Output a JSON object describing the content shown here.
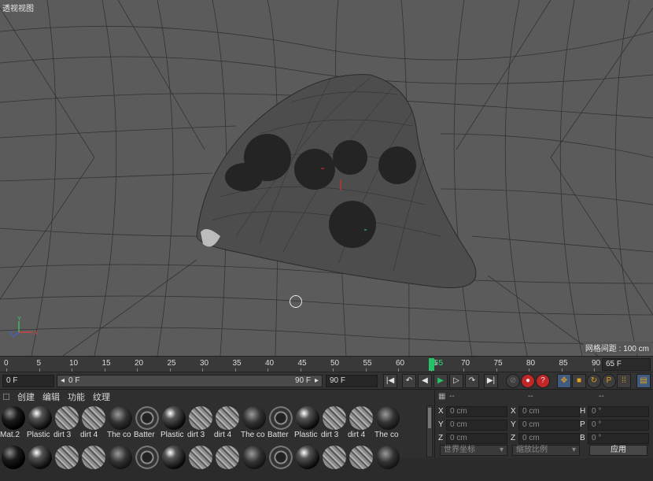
{
  "viewport": {
    "title": "透视视图",
    "grid_spacing": "网格间距 : 100 cm",
    "axes": {
      "x": "X",
      "y": "Y",
      "z": "Z"
    }
  },
  "timeline": {
    "ticks": [
      "0",
      "5",
      "10",
      "15",
      "20",
      "25",
      "30",
      "35",
      "40",
      "45",
      "50",
      "55",
      "60",
      "65",
      "70",
      "75",
      "80",
      "85",
      "90"
    ],
    "current_frame_label": "65",
    "current_frame": 65,
    "frame_field": "65 F"
  },
  "transport": {
    "start_field": "0 F",
    "range_start": "0 F",
    "range_end": "90 F",
    "end_field": "90 F",
    "buttons": [
      {
        "name": "go-to-start-button",
        "glyph": "|◀"
      },
      {
        "name": "prev-key-button",
        "glyph": "↶"
      },
      {
        "name": "prev-frame-button",
        "glyph": "◀"
      },
      {
        "name": "play-button",
        "glyph": "▶"
      },
      {
        "name": "next-frame-button",
        "glyph": "▷"
      },
      {
        "name": "next-key-button",
        "glyph": "↷"
      },
      {
        "name": "go-to-end-button",
        "glyph": "▶|"
      }
    ],
    "accent_play": "#26c26b",
    "accent_record": "#d93030",
    "accent_key": "#e0a020"
  },
  "material_manager": {
    "menu": [
      "创建",
      "编辑",
      "功能",
      "纹理"
    ],
    "materials": [
      {
        "label": "Mat.2",
        "kind": "black"
      },
      {
        "label": "Plastic",
        "kind": "plastic"
      },
      {
        "label": "dirt 3",
        "kind": "dirt"
      },
      {
        "label": "dirt 4",
        "kind": "dirt"
      },
      {
        "label": "The co",
        "kind": "coat"
      },
      {
        "label": "Batter",
        "kind": "battery"
      },
      {
        "label": "Plastic",
        "kind": "plastic"
      },
      {
        "label": "dirt 3",
        "kind": "dirt"
      },
      {
        "label": "dirt 4",
        "kind": "dirt"
      },
      {
        "label": "The co",
        "kind": "coat"
      },
      {
        "label": "Batter",
        "kind": "battery"
      },
      {
        "label": "Plastic",
        "kind": "plastic"
      },
      {
        "label": "dirt 3",
        "kind": "dirt"
      },
      {
        "label": "dirt 4",
        "kind": "dirt"
      },
      {
        "label": "The co",
        "kind": "coat"
      }
    ]
  },
  "attributes": {
    "head": [
      "--",
      "--",
      "--"
    ],
    "rows": [
      [
        {
          "k": "X",
          "v": "0 cm"
        },
        {
          "k": "X",
          "v": "0 cm"
        },
        {
          "k": "H",
          "v": "0 °"
        }
      ],
      [
        {
          "k": "Y",
          "v": "0 cm"
        },
        {
          "k": "Y",
          "v": "0 cm"
        },
        {
          "k": "P",
          "v": "0 °"
        }
      ],
      [
        {
          "k": "Z",
          "v": "0 cm"
        },
        {
          "k": "Z",
          "v": "0 cm"
        },
        {
          "k": "B",
          "v": "0 °"
        }
      ]
    ],
    "coord_system": "世界坐标",
    "scale_mode": "缩放比例",
    "apply_label": "应用"
  }
}
